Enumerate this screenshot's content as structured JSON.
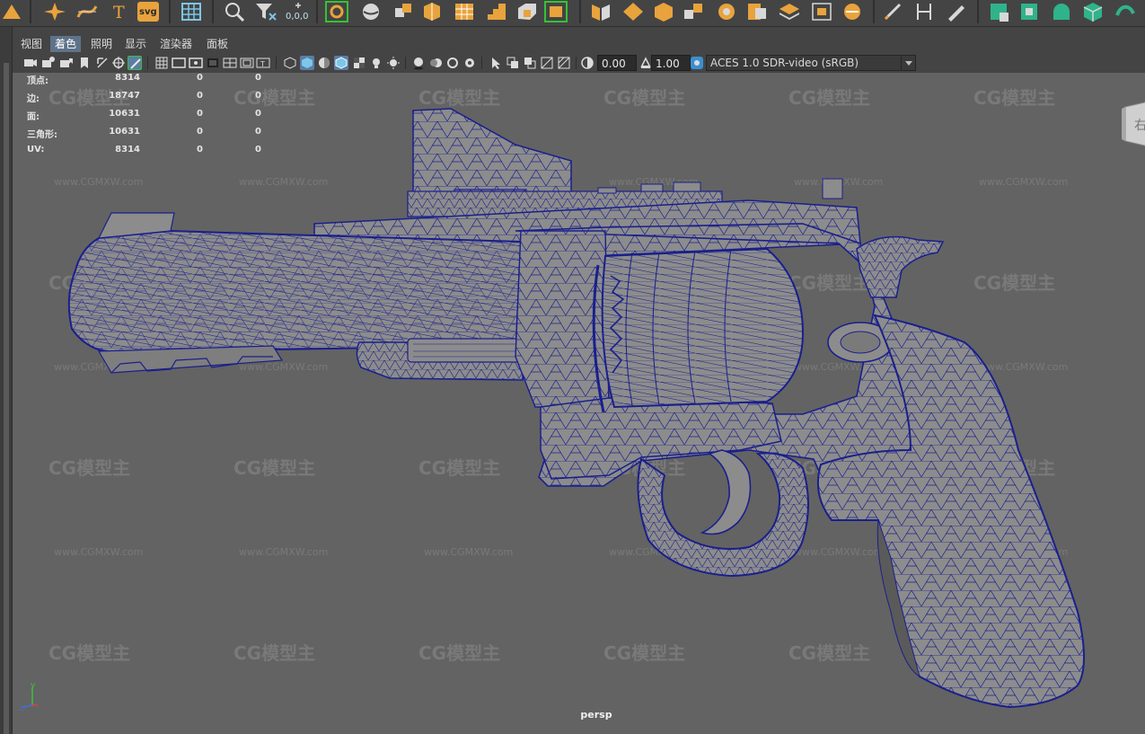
{
  "panel_menu": {
    "items": [
      {
        "label": "视图"
      },
      {
        "label": "着色",
        "active": true
      },
      {
        "label": "照明"
      },
      {
        "label": "显示"
      },
      {
        "label": "渲染器"
      },
      {
        "label": "面板"
      }
    ]
  },
  "panel_toolbar": {
    "exposure_value": "0.00",
    "gamma_value": "1.00",
    "color_management": "ACES 1.0 SDR-video (sRGB)"
  },
  "shelf": {
    "coordinate_readout": "0,0,0",
    "svg_label": "svg",
    "text_tool_label": "T"
  },
  "hud": {
    "rows": [
      {
        "label": "顶点:",
        "v1": "8314",
        "v2": "0",
        "v3": "0"
      },
      {
        "label": "边:",
        "v1": "18747",
        "v2": "0",
        "v3": "0"
      },
      {
        "label": "面:",
        "v1": "10631",
        "v2": "0",
        "v3": "0"
      },
      {
        "label": "三角形:",
        "v1": "10631",
        "v2": "0",
        "v3": "0"
      },
      {
        "label": "UV:",
        "v1": "8314",
        "v2": "0",
        "v3": "0"
      }
    ]
  },
  "viewport": {
    "camera_name": "persp",
    "watermark_logo": "CG模型主",
    "watermark_url": "www.CGMXW.com",
    "wire_color": "#1a1f8c",
    "mesh_color": "#8c8c8c",
    "background_color": "#636363"
  },
  "axis": {
    "y": "y",
    "z": "z"
  }
}
